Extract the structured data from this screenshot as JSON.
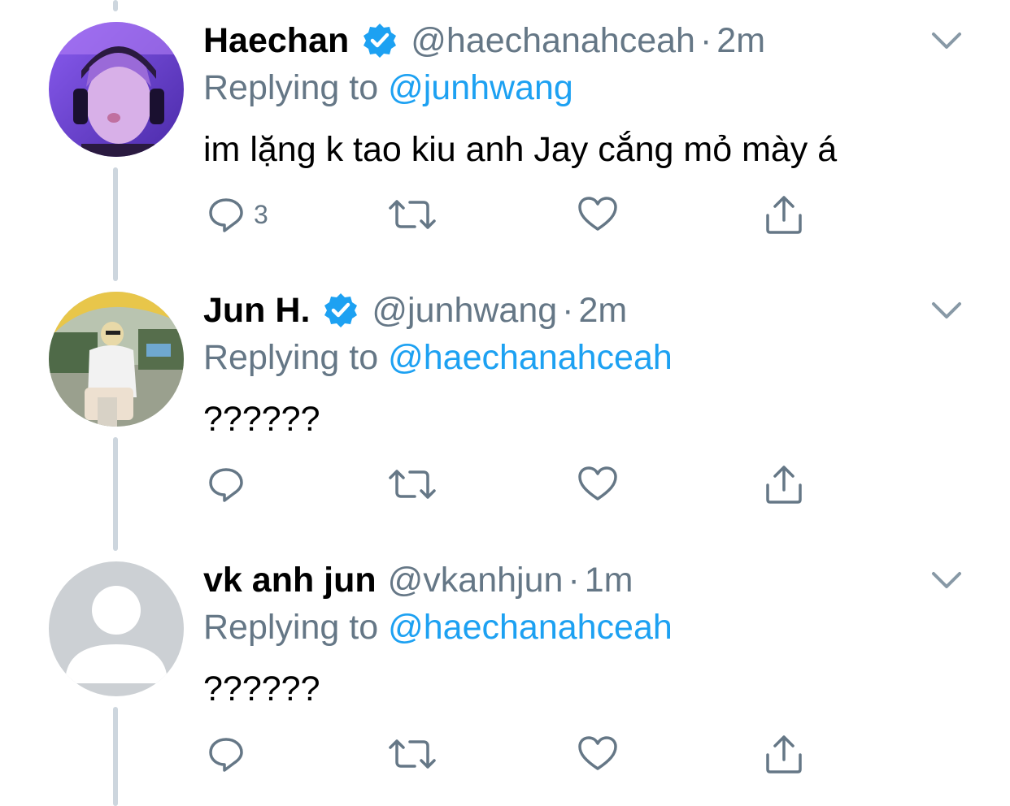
{
  "tweets": [
    {
      "display_name": "Haechan",
      "verified": true,
      "handle": "@haechanahceah",
      "separator": "·",
      "time": "2m",
      "replying_prefix": "Replying to",
      "replying_to": "@junhwang",
      "text": "im lặng k tao kiu anh Jay cắng mỏ mày á",
      "reply_count": "3"
    },
    {
      "display_name": "Jun H.",
      "verified": true,
      "handle": "@junhwang",
      "separator": "·",
      "time": "2m",
      "replying_prefix": "Replying to",
      "replying_to": "@haechanahceah",
      "text": "??????",
      "reply_count": ""
    },
    {
      "display_name": "vk anh jun",
      "verified": false,
      "handle": "@vkanhjun",
      "separator": "·",
      "time": "1m",
      "replying_prefix": "Replying to",
      "replying_to": "@haechanahceah",
      "text": "??????",
      "reply_count": ""
    }
  ],
  "icons": {
    "verified": "verified-badge-icon",
    "caret": "chevron-down-icon",
    "reply": "reply-bubble-icon",
    "retweet": "retweet-icon",
    "like": "heart-icon",
    "share": "share-upload-icon"
  },
  "colors": {
    "text": "#000000",
    "secondary": "#657786",
    "link": "#1da1f2",
    "verified": "#1da1f2",
    "thread_line": "#cdd6de",
    "icon": "#657786"
  }
}
